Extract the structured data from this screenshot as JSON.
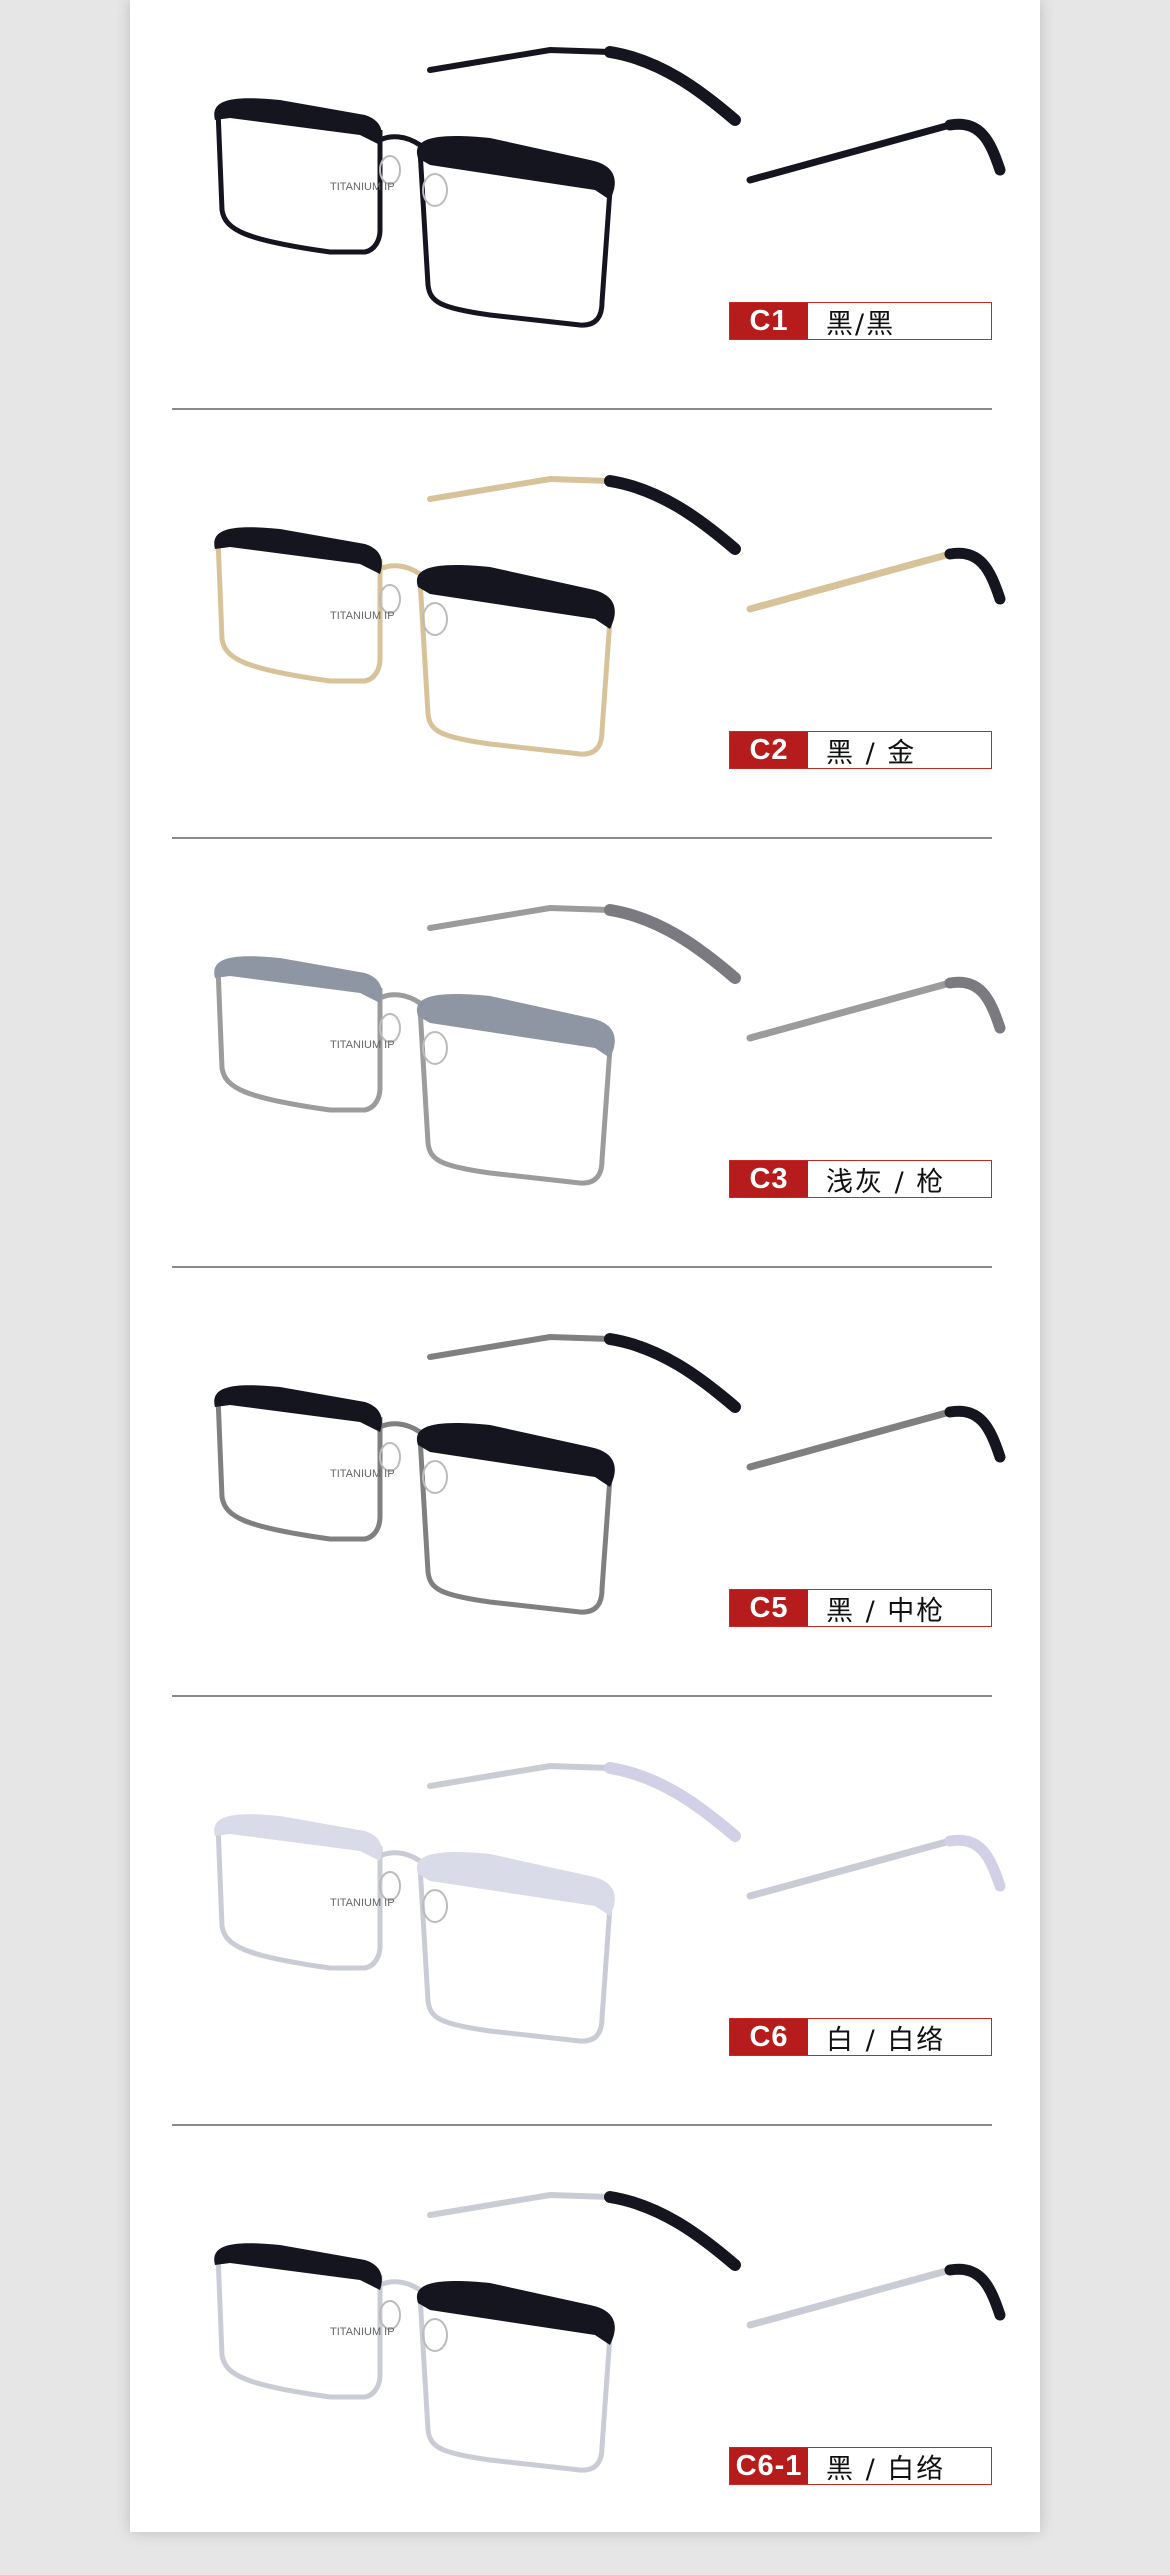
{
  "variants": [
    {
      "code": "C1",
      "color_name": "黑/黑",
      "front": "#151520",
      "rim": "#151520",
      "temple": "#151520",
      "tip": "#151520"
    },
    {
      "code": "C2",
      "color_name": "黑 / 金",
      "front": "#151520",
      "rim": "#d8c29a",
      "temple": "#d8c29a",
      "tip": "#151520"
    },
    {
      "code": "C3",
      "color_name": "浅灰 / 枪",
      "front": "#8e96a3",
      "rim": "#9c9c9c",
      "temple": "#9c9c9c",
      "tip": "#7a7a80"
    },
    {
      "code": "C5",
      "color_name": "黑 / 中枪",
      "front": "#151520",
      "rim": "#808080",
      "temple": "#808080",
      "tip": "#151520"
    },
    {
      "code": "C6",
      "color_name": "白 / 白络",
      "front": "#d9dbe8",
      "rim": "#c9ccd4",
      "temple": "#c9ccd4",
      "tip": "#d2d0e6"
    },
    {
      "code": "C6-1",
      "color_name": "黑 / 白络",
      "front": "#151520",
      "rim": "#c9ccd4",
      "temple": "#c9ccd4",
      "tip": "#151520"
    }
  ],
  "frame_imprint": "TITANIUM IP",
  "colors": {
    "label_red": "#b71c1c",
    "divider": "#8a8a8a",
    "background": "#e6e6e6"
  }
}
